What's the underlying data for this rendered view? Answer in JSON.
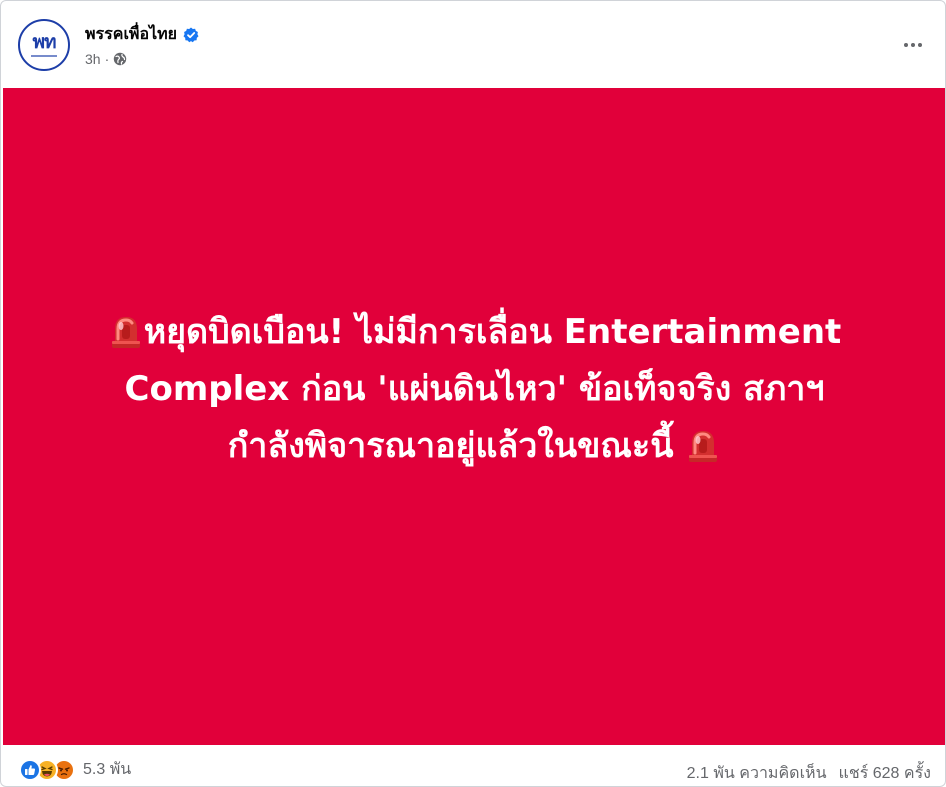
{
  "post": {
    "page_name": "พรรคเพื่อไทย",
    "avatar_text": "พท",
    "time": "3h",
    "separator": "·",
    "audience_icon": "globe-icon",
    "verified_icon": "verified-badge-icon",
    "more_icon": "more-options-icon",
    "image": {
      "background_color": "#e1003a",
      "line1": "หยุดบิดเบือน! ไม่มีการเลื่อน Entertainment",
      "line2": "Complex ก่อน 'แผ่นดินไหว' ข้อเท็จจริง สภาฯ",
      "line3": "กำลังพิจารณาอยู่แล้วในขณะนี้",
      "emoji_icon": "siren-icon"
    },
    "reactions": {
      "icons": [
        "like-icon",
        "haha-icon",
        "angry-icon"
      ],
      "count": "5.3 พัน"
    },
    "comments": "2.1 พัน ความคิดเห็น",
    "shares": "แชร์ 628 ครั้ง"
  }
}
